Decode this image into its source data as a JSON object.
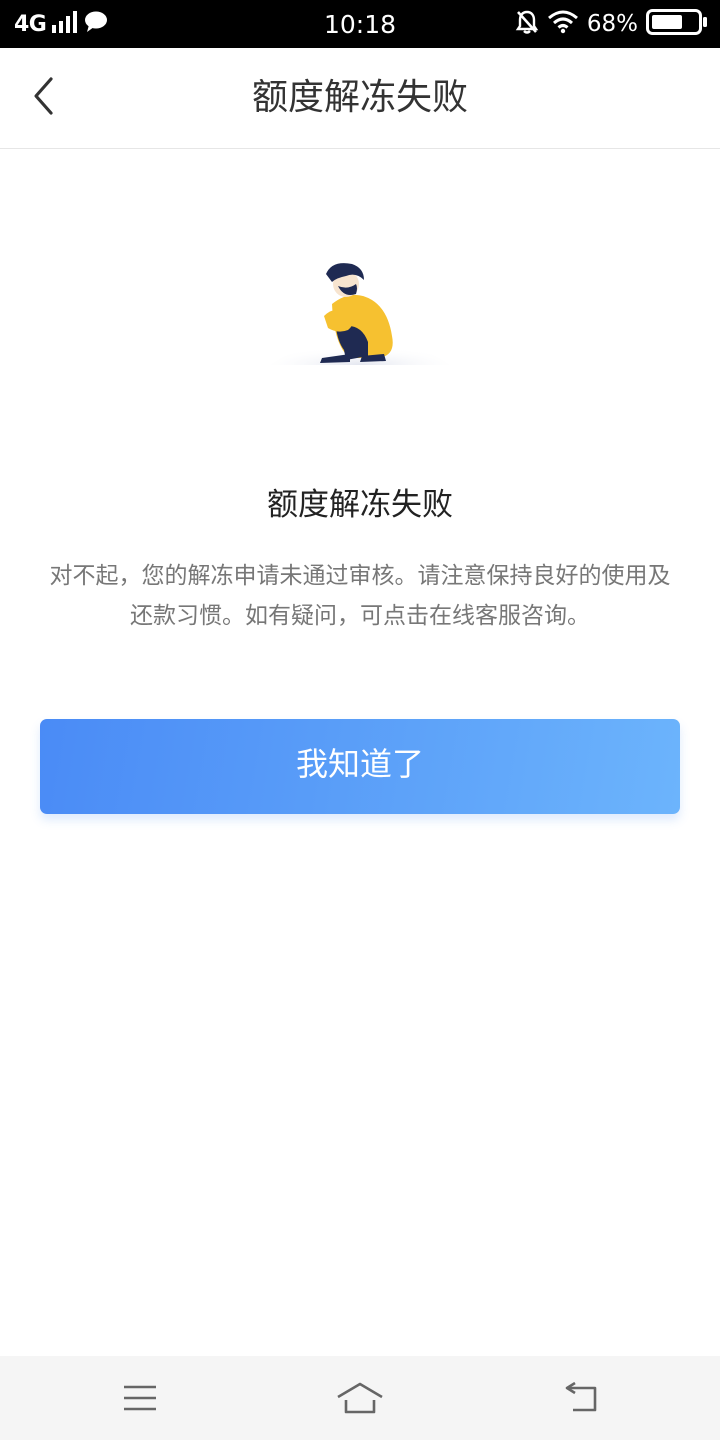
{
  "status_bar": {
    "network": "4G",
    "time": "10:18",
    "battery": "68%"
  },
  "header": {
    "title": "额度解冻失败",
    "back_icon": "chevron-left-icon"
  },
  "result": {
    "title": "额度解冻失败",
    "description": "对不起，您的解冻申请未通过审核。请注意保持良好的使用及还款习惯。如有疑问，可点击在线客服咨询。"
  },
  "confirm_button": {
    "label": "我知道了",
    "gradient_start": "#4a8bf6",
    "gradient_end": "#6cb4fc"
  },
  "system_nav": {
    "icons": [
      "menu-icon",
      "home-icon",
      "back-icon"
    ]
  },
  "colors": {
    "status_bar_bg": "#000000",
    "title_text": "#333333",
    "desc_text": "#777777",
    "illustration_yellow": "#f6c130",
    "illustration_navy": "#1f2a52"
  }
}
